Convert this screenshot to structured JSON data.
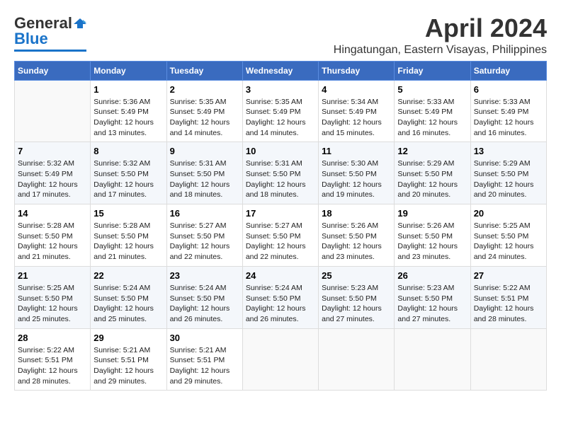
{
  "header": {
    "logo_general": "General",
    "logo_blue": "Blue",
    "month_title": "April 2024",
    "location": "Hingatungan, Eastern Visayas, Philippines"
  },
  "days_of_week": [
    "Sunday",
    "Monday",
    "Tuesday",
    "Wednesday",
    "Thursday",
    "Friday",
    "Saturday"
  ],
  "weeks": [
    [
      {
        "day": "",
        "sunrise": "",
        "sunset": "",
        "daylight": ""
      },
      {
        "day": "1",
        "sunrise": "Sunrise: 5:36 AM",
        "sunset": "Sunset: 5:49 PM",
        "daylight": "Daylight: 12 hours and 13 minutes."
      },
      {
        "day": "2",
        "sunrise": "Sunrise: 5:35 AM",
        "sunset": "Sunset: 5:49 PM",
        "daylight": "Daylight: 12 hours and 14 minutes."
      },
      {
        "day": "3",
        "sunrise": "Sunrise: 5:35 AM",
        "sunset": "Sunset: 5:49 PM",
        "daylight": "Daylight: 12 hours and 14 minutes."
      },
      {
        "day": "4",
        "sunrise": "Sunrise: 5:34 AM",
        "sunset": "Sunset: 5:49 PM",
        "daylight": "Daylight: 12 hours and 15 minutes."
      },
      {
        "day": "5",
        "sunrise": "Sunrise: 5:33 AM",
        "sunset": "Sunset: 5:49 PM",
        "daylight": "Daylight: 12 hours and 16 minutes."
      },
      {
        "day": "6",
        "sunrise": "Sunrise: 5:33 AM",
        "sunset": "Sunset: 5:49 PM",
        "daylight": "Daylight: 12 hours and 16 minutes."
      }
    ],
    [
      {
        "day": "7",
        "sunrise": "Sunrise: 5:32 AM",
        "sunset": "Sunset: 5:49 PM",
        "daylight": "Daylight: 12 hours and 17 minutes."
      },
      {
        "day": "8",
        "sunrise": "Sunrise: 5:32 AM",
        "sunset": "Sunset: 5:50 PM",
        "daylight": "Daylight: 12 hours and 17 minutes."
      },
      {
        "day": "9",
        "sunrise": "Sunrise: 5:31 AM",
        "sunset": "Sunset: 5:50 PM",
        "daylight": "Daylight: 12 hours and 18 minutes."
      },
      {
        "day": "10",
        "sunrise": "Sunrise: 5:31 AM",
        "sunset": "Sunset: 5:50 PM",
        "daylight": "Daylight: 12 hours and 18 minutes."
      },
      {
        "day": "11",
        "sunrise": "Sunrise: 5:30 AM",
        "sunset": "Sunset: 5:50 PM",
        "daylight": "Daylight: 12 hours and 19 minutes."
      },
      {
        "day": "12",
        "sunrise": "Sunrise: 5:29 AM",
        "sunset": "Sunset: 5:50 PM",
        "daylight": "Daylight: 12 hours and 20 minutes."
      },
      {
        "day": "13",
        "sunrise": "Sunrise: 5:29 AM",
        "sunset": "Sunset: 5:50 PM",
        "daylight": "Daylight: 12 hours and 20 minutes."
      }
    ],
    [
      {
        "day": "14",
        "sunrise": "Sunrise: 5:28 AM",
        "sunset": "Sunset: 5:50 PM",
        "daylight": "Daylight: 12 hours and 21 minutes."
      },
      {
        "day": "15",
        "sunrise": "Sunrise: 5:28 AM",
        "sunset": "Sunset: 5:50 PM",
        "daylight": "Daylight: 12 hours and 21 minutes."
      },
      {
        "day": "16",
        "sunrise": "Sunrise: 5:27 AM",
        "sunset": "Sunset: 5:50 PM",
        "daylight": "Daylight: 12 hours and 22 minutes."
      },
      {
        "day": "17",
        "sunrise": "Sunrise: 5:27 AM",
        "sunset": "Sunset: 5:50 PM",
        "daylight": "Daylight: 12 hours and 22 minutes."
      },
      {
        "day": "18",
        "sunrise": "Sunrise: 5:26 AM",
        "sunset": "Sunset: 5:50 PM",
        "daylight": "Daylight: 12 hours and 23 minutes."
      },
      {
        "day": "19",
        "sunrise": "Sunrise: 5:26 AM",
        "sunset": "Sunset: 5:50 PM",
        "daylight": "Daylight: 12 hours and 23 minutes."
      },
      {
        "day": "20",
        "sunrise": "Sunrise: 5:25 AM",
        "sunset": "Sunset: 5:50 PM",
        "daylight": "Daylight: 12 hours and 24 minutes."
      }
    ],
    [
      {
        "day": "21",
        "sunrise": "Sunrise: 5:25 AM",
        "sunset": "Sunset: 5:50 PM",
        "daylight": "Daylight: 12 hours and 25 minutes."
      },
      {
        "day": "22",
        "sunrise": "Sunrise: 5:24 AM",
        "sunset": "Sunset: 5:50 PM",
        "daylight": "Daylight: 12 hours and 25 minutes."
      },
      {
        "day": "23",
        "sunrise": "Sunrise: 5:24 AM",
        "sunset": "Sunset: 5:50 PM",
        "daylight": "Daylight: 12 hours and 26 minutes."
      },
      {
        "day": "24",
        "sunrise": "Sunrise: 5:24 AM",
        "sunset": "Sunset: 5:50 PM",
        "daylight": "Daylight: 12 hours and 26 minutes."
      },
      {
        "day": "25",
        "sunrise": "Sunrise: 5:23 AM",
        "sunset": "Sunset: 5:50 PM",
        "daylight": "Daylight: 12 hours and 27 minutes."
      },
      {
        "day": "26",
        "sunrise": "Sunrise: 5:23 AM",
        "sunset": "Sunset: 5:50 PM",
        "daylight": "Daylight: 12 hours and 27 minutes."
      },
      {
        "day": "27",
        "sunrise": "Sunrise: 5:22 AM",
        "sunset": "Sunset: 5:51 PM",
        "daylight": "Daylight: 12 hours and 28 minutes."
      }
    ],
    [
      {
        "day": "28",
        "sunrise": "Sunrise: 5:22 AM",
        "sunset": "Sunset: 5:51 PM",
        "daylight": "Daylight: 12 hours and 28 minutes."
      },
      {
        "day": "29",
        "sunrise": "Sunrise: 5:21 AM",
        "sunset": "Sunset: 5:51 PM",
        "daylight": "Daylight: 12 hours and 29 minutes."
      },
      {
        "day": "30",
        "sunrise": "Sunrise: 5:21 AM",
        "sunset": "Sunset: 5:51 PM",
        "daylight": "Daylight: 12 hours and 29 minutes."
      },
      {
        "day": "",
        "sunrise": "",
        "sunset": "",
        "daylight": ""
      },
      {
        "day": "",
        "sunrise": "",
        "sunset": "",
        "daylight": ""
      },
      {
        "day": "",
        "sunrise": "",
        "sunset": "",
        "daylight": ""
      },
      {
        "day": "",
        "sunrise": "",
        "sunset": "",
        "daylight": ""
      }
    ]
  ]
}
